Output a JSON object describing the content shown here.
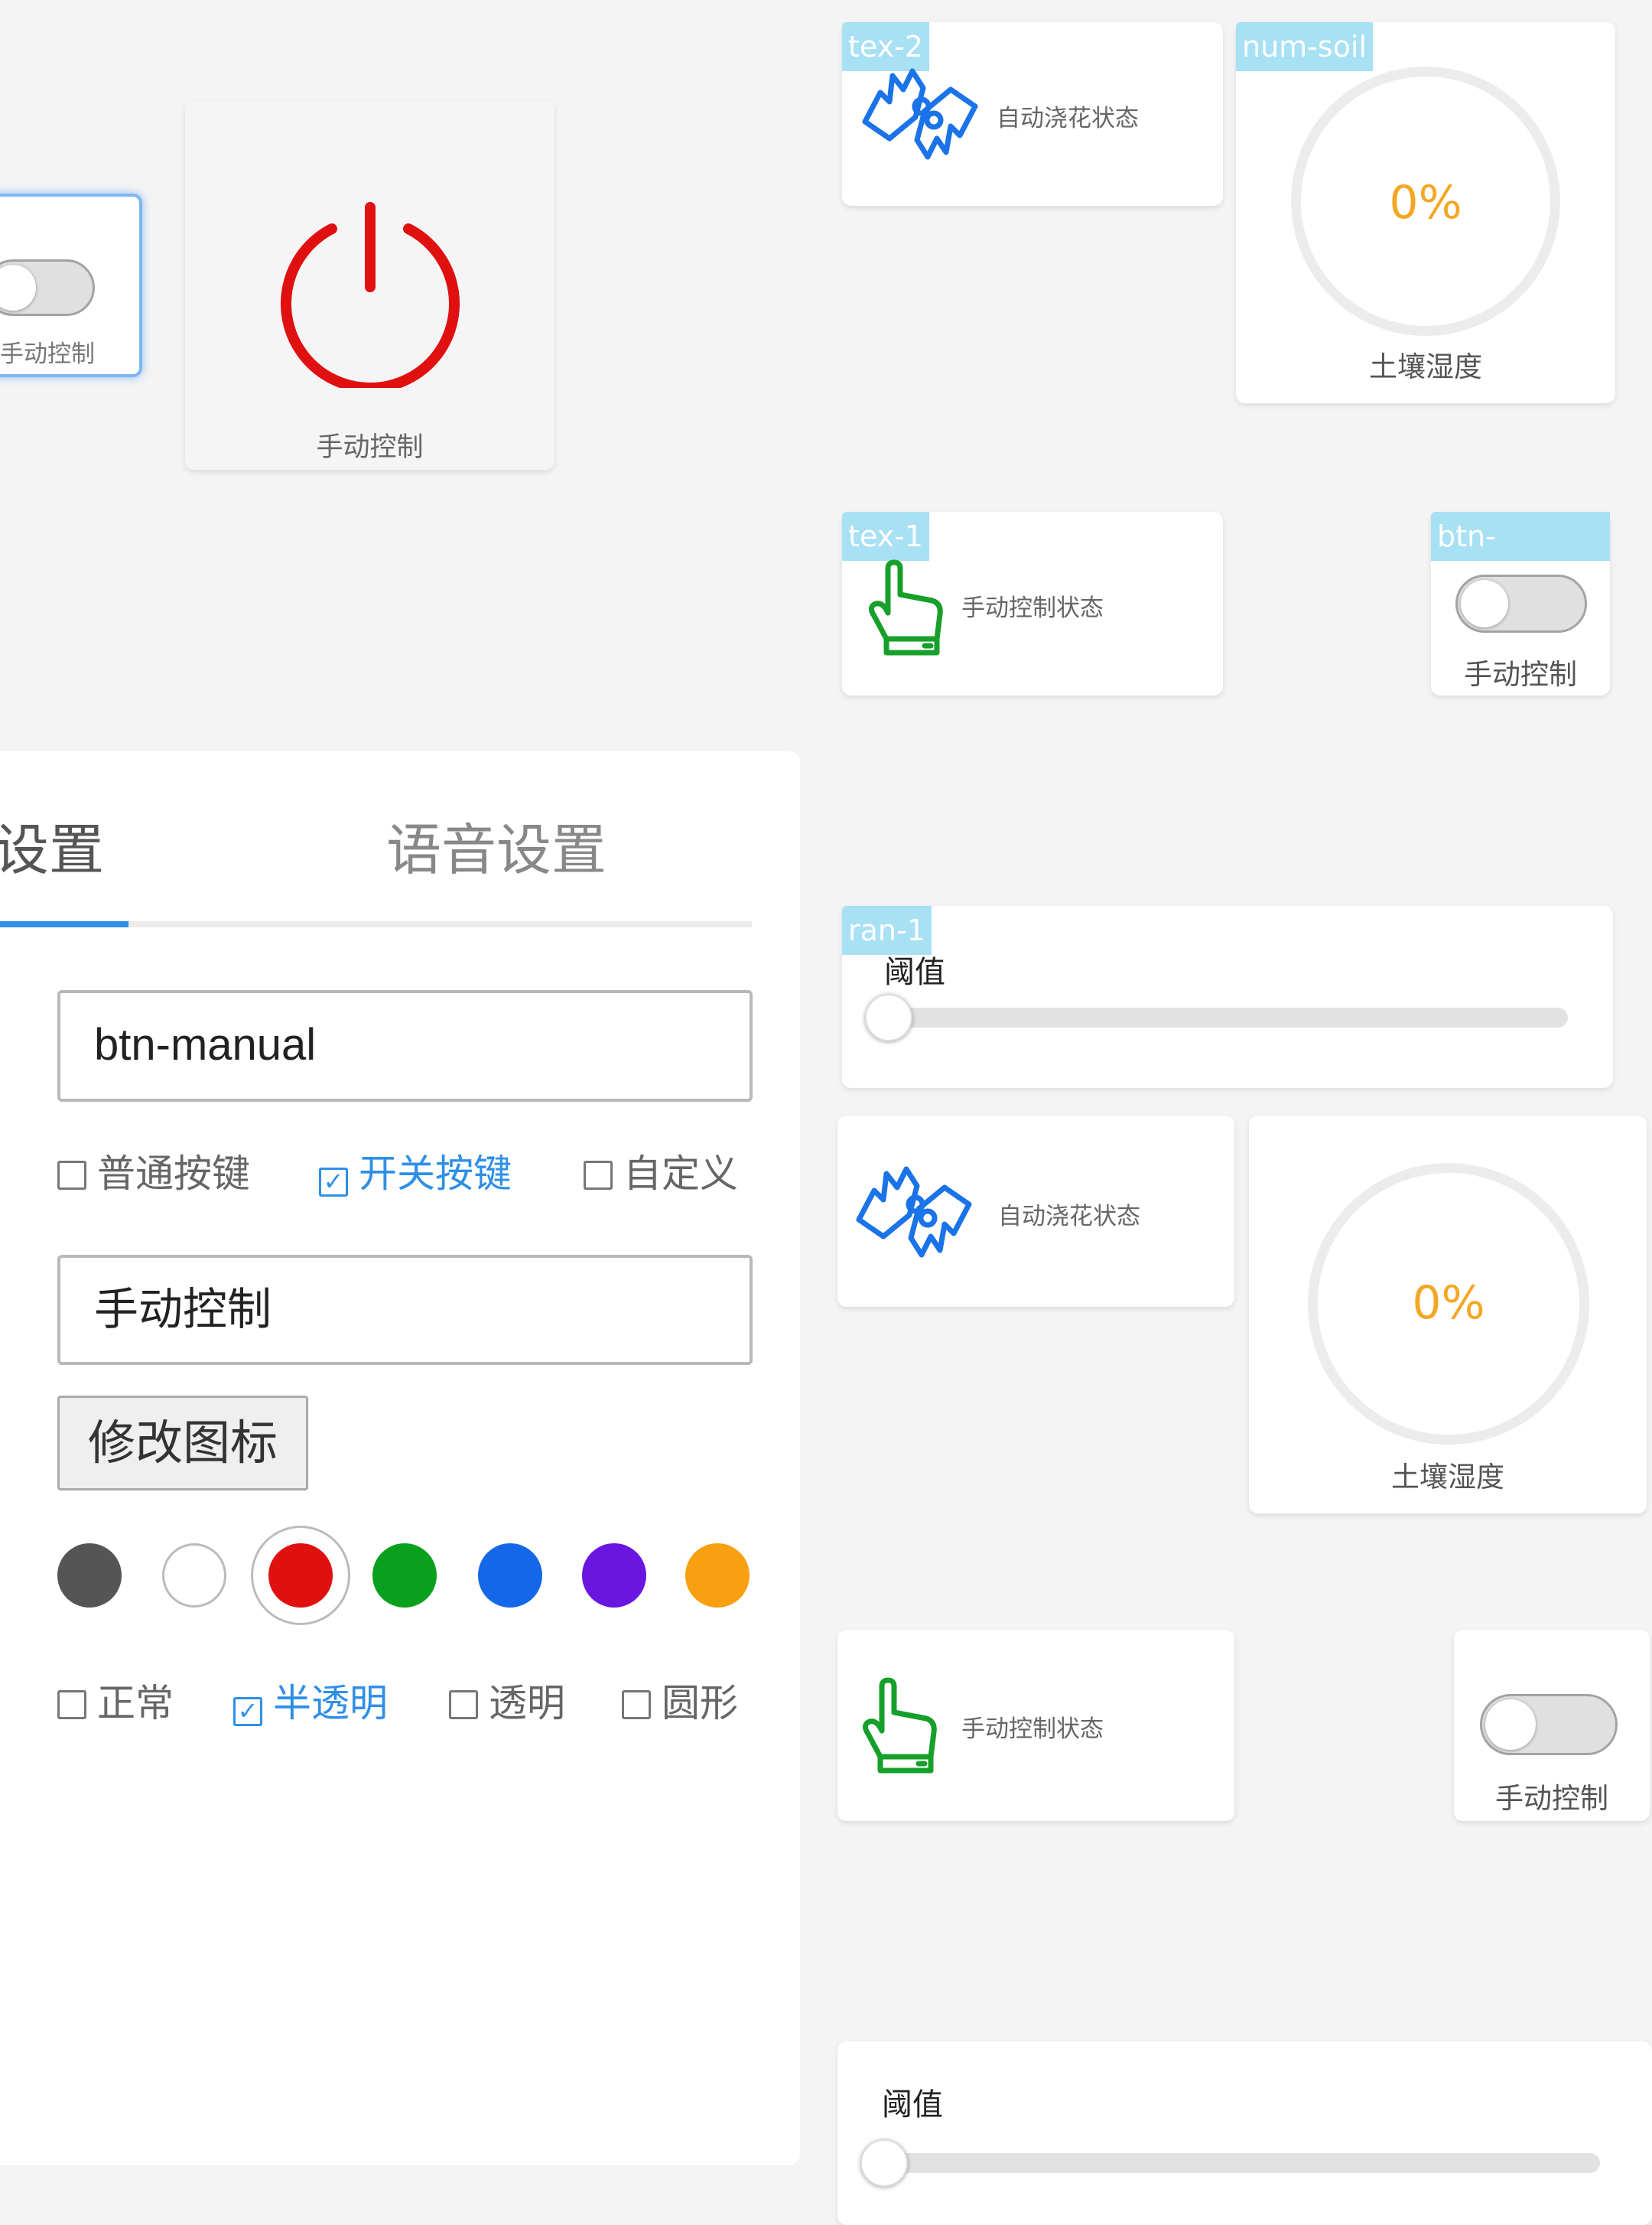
{
  "widgets": {
    "selected_toggle": {
      "label": "手动控制"
    },
    "power_button": {
      "label": "手动控制",
      "color": "#e01010"
    },
    "tex2": {
      "tag": "tex-2",
      "label": "自动浇花状态"
    },
    "num_soil": {
      "tag": "num-soil",
      "value": "0%",
      "label": "土壤湿度"
    },
    "tex1": {
      "tag": "tex-1",
      "label": "手动控制状态"
    },
    "btn_manual": {
      "tag": "btn-manual",
      "label": "手动控制"
    },
    "ran1": {
      "tag": "ran-1",
      "label": "阈值",
      "value": 0
    }
  },
  "preview": {
    "tex2": {
      "label": "自动浇花状态"
    },
    "num_soil": {
      "value": "0%",
      "label": "土壤湿度"
    },
    "tex1": {
      "label": "手动控制状态"
    },
    "btn_manual": {
      "label": "手动控制"
    },
    "ran1": {
      "label": "阈值",
      "value": 0
    }
  },
  "settings_panel": {
    "tabs": [
      {
        "label": "础设置",
        "active": true
      },
      {
        "label": "语音设置",
        "active": false
      }
    ],
    "id_field_value": "btn-manual",
    "button_types": [
      {
        "label": "普通按键",
        "checked": false
      },
      {
        "label": "开关按键",
        "checked": true
      },
      {
        "label": "自定义",
        "checked": false
      }
    ],
    "name_field_value": "手动控制",
    "change_icon_label": "修改图标",
    "colors": [
      "#555555",
      "#ffffff",
      "#e01010",
      "#0aa01e",
      "#1468e8",
      "#6a16e0",
      "#f8a010"
    ],
    "selected_color": "#e01010",
    "styles": [
      {
        "label": "正常",
        "checked": false
      },
      {
        "label": "半透明",
        "checked": true
      },
      {
        "label": "透明",
        "checked": false
      },
      {
        "label": "圆形",
        "checked": false
      }
    ]
  },
  "colors": {
    "accent": "#2f8fe6",
    "tag_bg": "#a8e0f4",
    "blue_icon": "#1a73e8",
    "green_icon": "#16a02a",
    "gauge_text": "#f5a623"
  },
  "icons": {
    "tex2": "two-hands-icon",
    "tex1": "pointing-hand-icon",
    "power": "power-icon"
  }
}
